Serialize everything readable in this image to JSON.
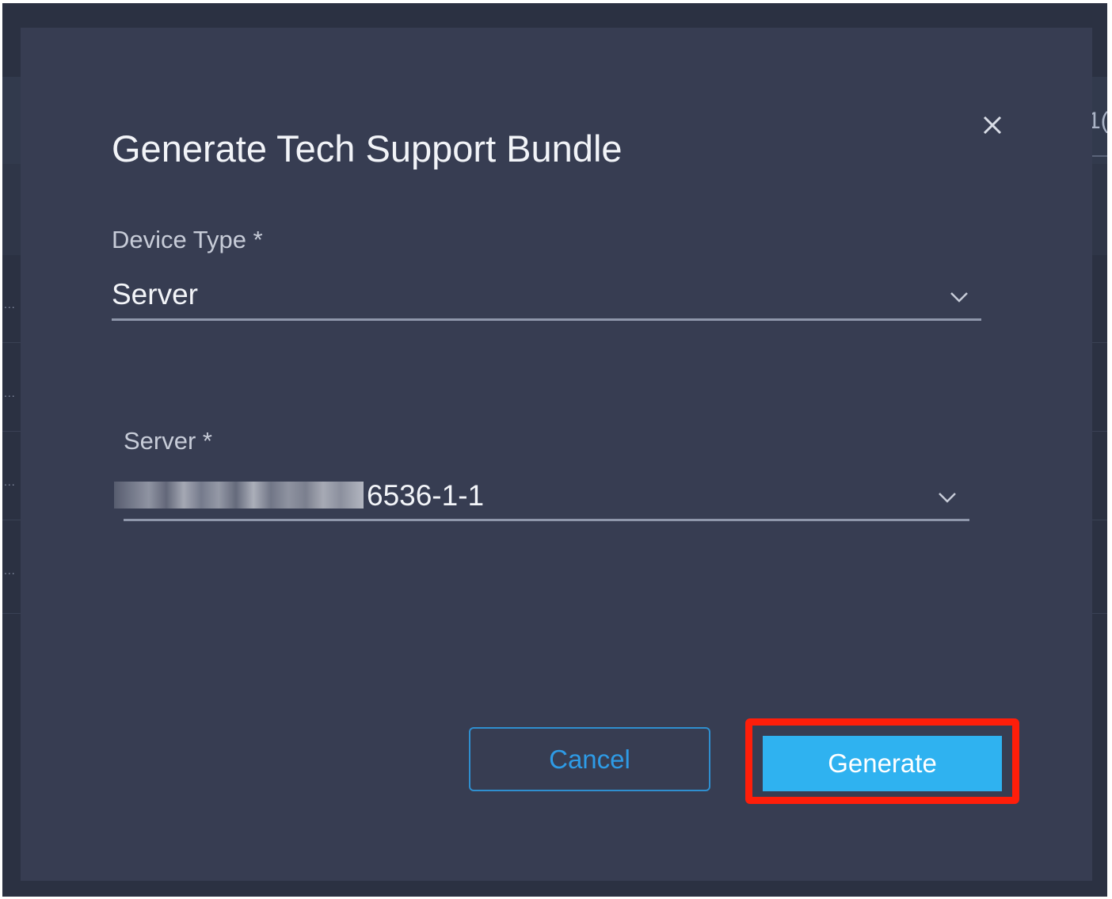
{
  "background": {
    "edge_text": "1(",
    "row_dots": [
      "...",
      "...",
      "...",
      "..."
    ]
  },
  "modal": {
    "title": "Generate Tech Support Bundle",
    "close_icon": "close-icon",
    "device_type": {
      "label": "Device Type *",
      "value": "Server",
      "icon": "chevron-down-icon"
    },
    "server": {
      "label": "Server *",
      "value_visible_suffix": "6536-1-1",
      "value_prefix_redacted": true,
      "icon": "chevron-down-icon"
    },
    "buttons": {
      "cancel_label": "Cancel",
      "generate_label": "Generate"
    }
  },
  "colors": {
    "modal_bg": "#373d52",
    "primary": "#2fb2f0",
    "secondary_text": "#2e9be6",
    "highlight": "#ff1e0a"
  }
}
